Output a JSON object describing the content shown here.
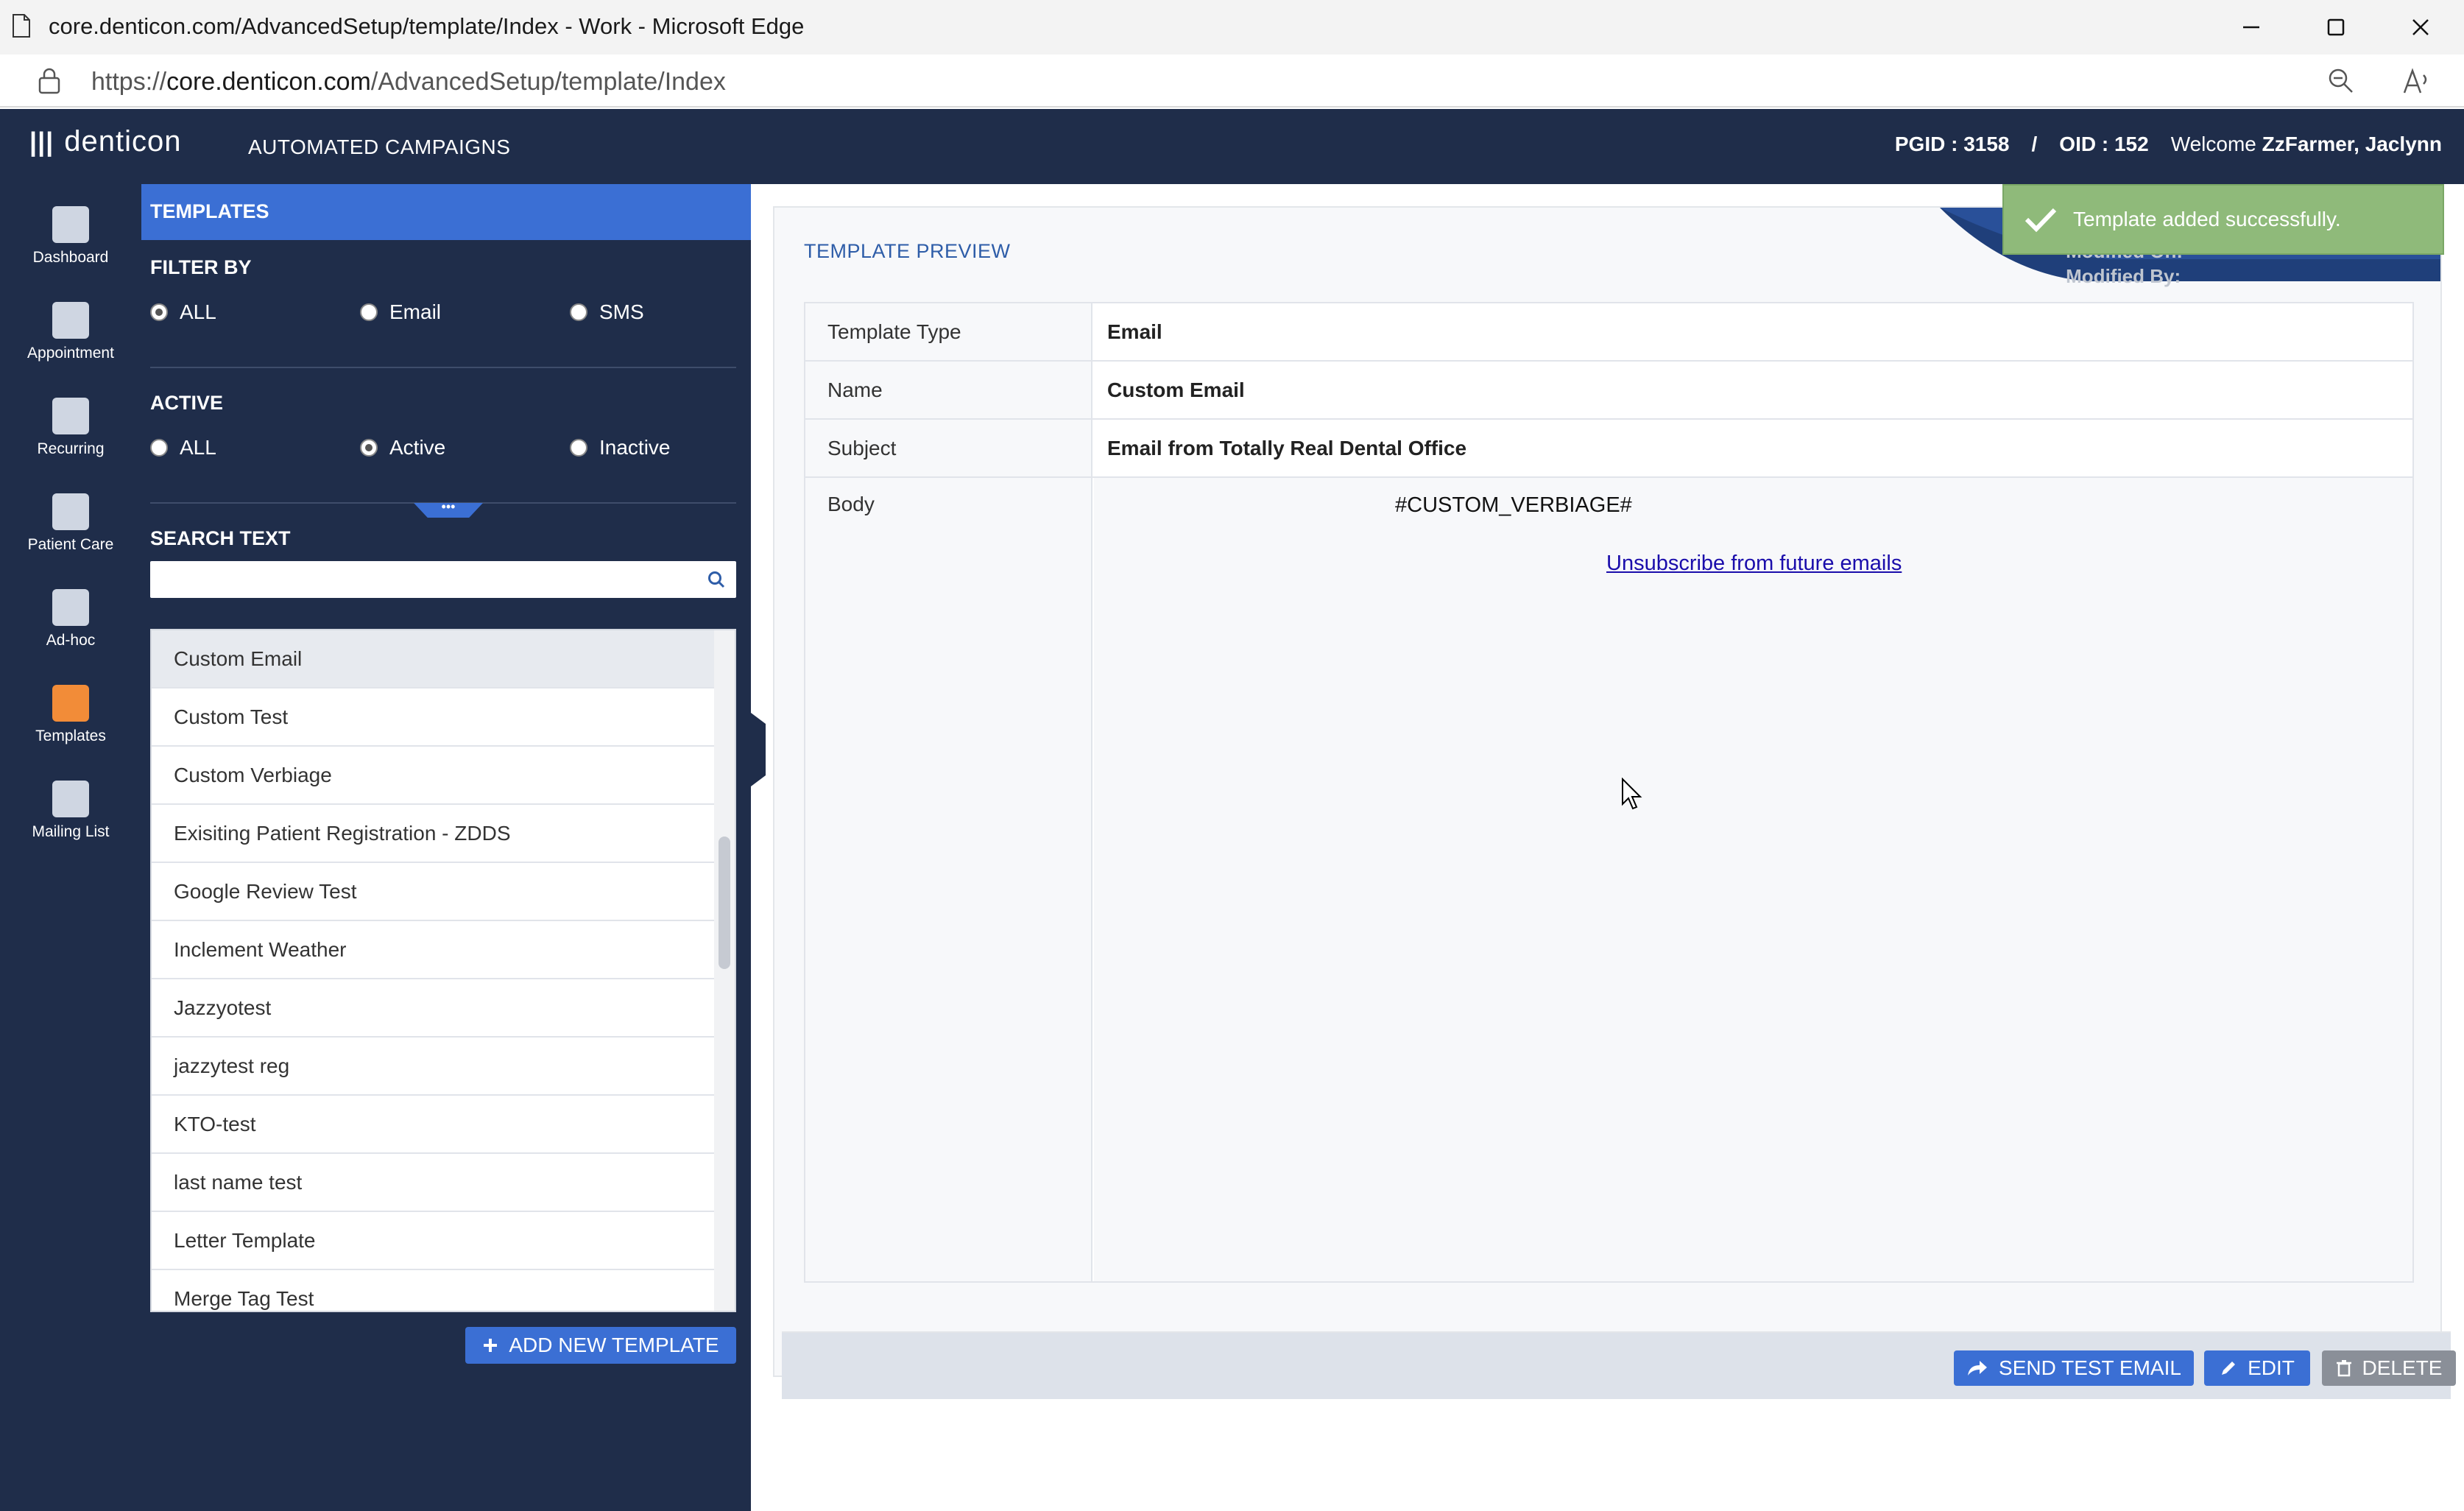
{
  "browser": {
    "title": "core.denticon.com/AdvancedSetup/template/Index - Work - Microsoft Edge",
    "url_prefix": "https://",
    "url_host": "core.denticon.com",
    "url_path": "/AdvancedSetup/template/Index"
  },
  "header": {
    "logo_bars": "|||",
    "logo_text": "denticon",
    "app_title": "AUTOMATED CAMPAIGNS",
    "pgid": "PGID : 3158",
    "slash": "/",
    "oid": "OID : 152",
    "welcome_prefix": "Welcome",
    "user_name": "ZzFarmer, Jaclynn"
  },
  "nav": {
    "items": [
      {
        "label": "Dashboard",
        "icon": "dashboard-icon"
      },
      {
        "label": "Appointment",
        "icon": "appointment-icon"
      },
      {
        "label": "Recurring",
        "icon": "recurring-icon"
      },
      {
        "label": "Patient Care",
        "icon": "patient-care-icon"
      },
      {
        "label": "Ad-hoc",
        "icon": "ad-hoc-icon"
      },
      {
        "label": "Templates",
        "icon": "templates-icon"
      },
      {
        "label": "Mailing List",
        "icon": "mailing-list-icon"
      }
    ],
    "active": "Templates"
  },
  "templates_panel": {
    "heading": "TEMPLATES",
    "filter_label": "FILTER BY",
    "filter_options": [
      "ALL",
      "Email",
      "SMS"
    ],
    "filter_selected": "ALL",
    "active_label": "ACTIVE",
    "active_options": [
      "ALL",
      "Active",
      "Inactive"
    ],
    "active_selected": "Active",
    "search_label": "SEARCH TEXT",
    "search_value": "",
    "list": [
      "Custom Email",
      "Custom Test",
      "Custom Verbiage",
      "Exisiting Patient Registration - ZDDS",
      "Google Review Test",
      "Inclement Weather",
      "Jazzyotest",
      "jazzytest reg",
      "KTO-test",
      "last name test",
      "Letter Template",
      "Merge Tag Test"
    ],
    "selected_item": "Custom Email",
    "add_button": "ADD NEW TEMPLATE"
  },
  "preview": {
    "title": "TEMPLATE PREVIEW",
    "modified_on_label": "Modified On:",
    "modified_by_label": "Modified By:",
    "rows": [
      {
        "label": "Template Type",
        "value": "Email"
      },
      {
        "label": "Name",
        "value": "Custom Email"
      },
      {
        "label": "Subject",
        "value": "Email from Totally Real Dental Office"
      },
      {
        "label": "Body",
        "value": ""
      }
    ],
    "body_verbiage": "#CUSTOM_VERBIAGE#",
    "body_unsubscribe": "Unsubscribe from future emails",
    "actions": {
      "send_test": "SEND TEST EMAIL",
      "edit": "EDIT",
      "delete": "DELETE"
    }
  },
  "toast": {
    "message": "Template added successfully."
  },
  "colors": {
    "navy": "#1f2d4a",
    "accent_blue": "#3b6fd4",
    "toast_green": "#8fba7a",
    "active_nav_icon": "#f28c38"
  }
}
